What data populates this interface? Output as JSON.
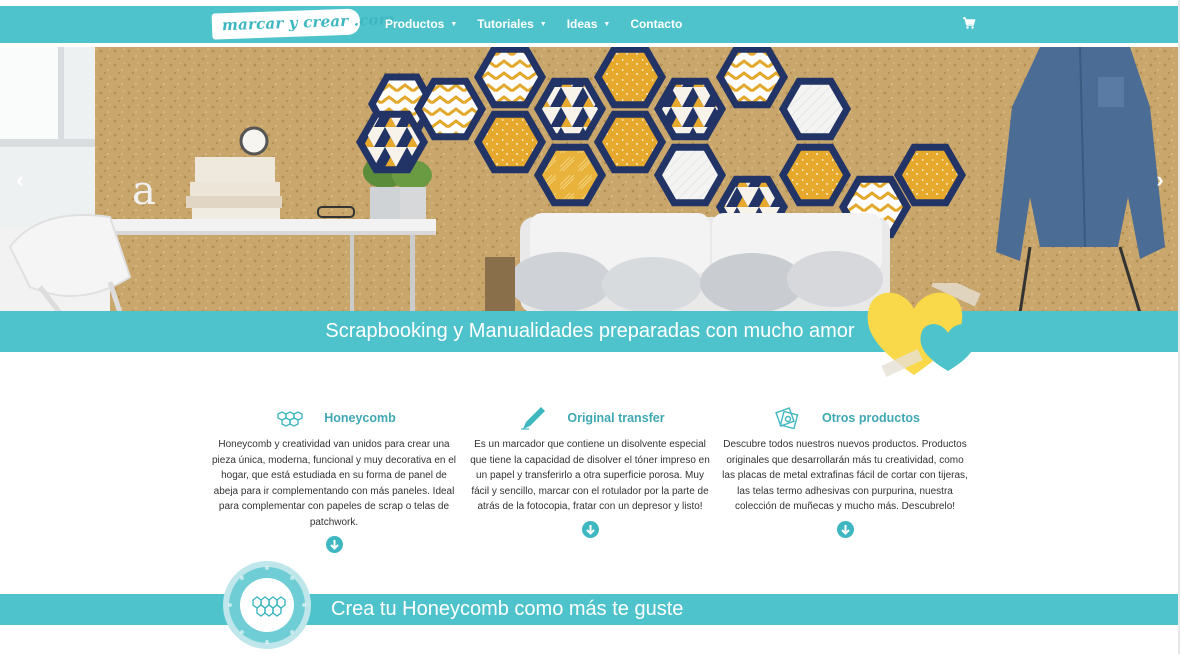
{
  "header": {
    "logo_text": "marcar y crear .com",
    "nav": [
      {
        "label": "Productos",
        "has_dropdown": true
      },
      {
        "label": "Tutoriales",
        "has_dropdown": true
      },
      {
        "label": "Ideas",
        "has_dropdown": true
      },
      {
        "label": "Contacto",
        "has_dropdown": false
      }
    ],
    "cart_icon": "cart-icon"
  },
  "hero": {
    "prev_icon": "chevron-left-icon",
    "next_icon": "chevron-right-icon",
    "banner_text": "Scrapbooking y Manualidades preparadas con mucho amor"
  },
  "features": [
    {
      "icon": "honeycomb-icon",
      "title": "Honeycomb",
      "description": "Honeycomb y creatividad van unidos para crear una pieza única, moderna, funcional y muy decorativa en el hogar, que está estudiada en su forma de panel de abeja para ir complementando con más paneles. Ideal para complementar con papeles de scrap o telas de patchwork."
    },
    {
      "icon": "marker-icon",
      "title": "Original transfer",
      "description": "Es un marcador que contiene un disolvente especial que tiene la capacidad de disolver el tóner impreso en un papel y transferirlo a otra superficie porosa. Muy fácil y sencillo, marcar con el rotulador por la parte de atrás de la fotocopia, fratar con un depresor y listo!"
    },
    {
      "icon": "products-icon",
      "title": "Otros productos",
      "description": "Descubre todos nuestros  nuevos productos. Productos originales que desarrollarán más tu creatividad, como las placas de metal extrafinas fácil de cortar con tijeras, las telas termo adhesivas con purpurina, nuestra colección de muñecas y mucho más. Descubrelo!"
    }
  ],
  "section2": {
    "title": "Crea tu Honeycomb como más te guste"
  },
  "colors": {
    "accent": "#4fc3cc",
    "accent_dark": "#3fa8b3",
    "heart_yellow": "#f9d94a",
    "hex_yellow": "#e7a92b",
    "hex_navy": "#223366"
  }
}
